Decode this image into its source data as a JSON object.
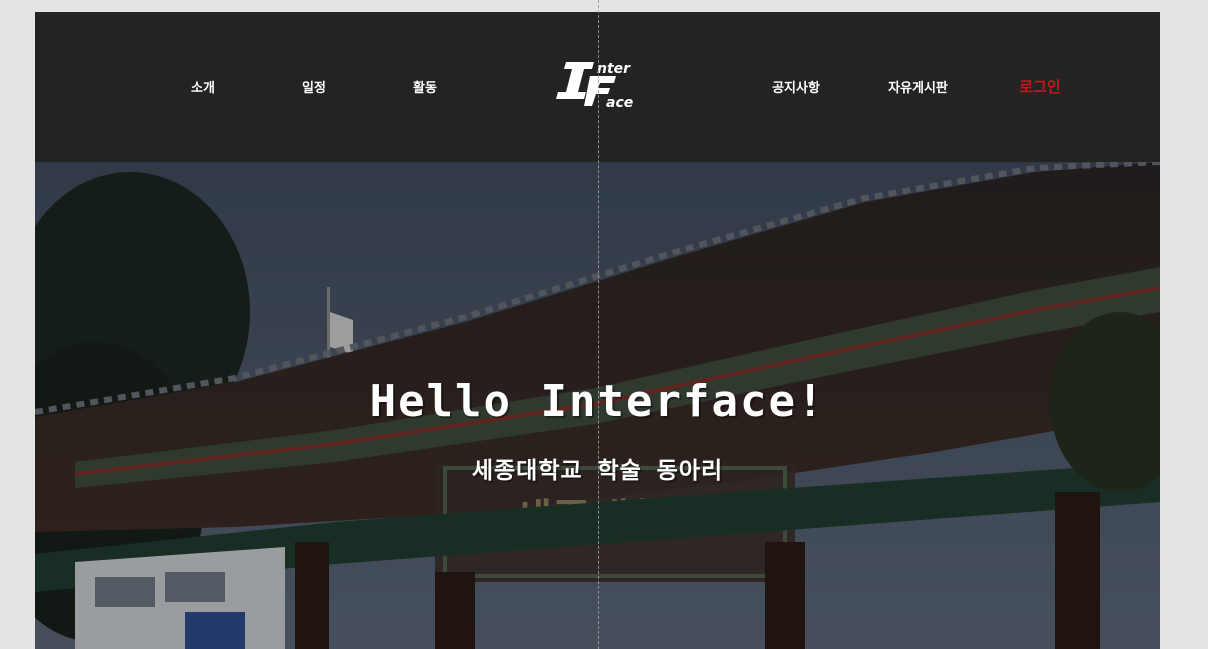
{
  "nav": {
    "left_items": [
      {
        "label": "소개"
      },
      {
        "label": "일정"
      },
      {
        "label": "활동"
      }
    ],
    "right_items": [
      {
        "label": "공지사항"
      },
      {
        "label": "자유게시판"
      }
    ],
    "login_label": "로그인",
    "logo_text": {
      "top": "nter",
      "bottom": "ace"
    }
  },
  "hero": {
    "title": "Hello Interface!",
    "subtitle": "세종대학교 학술 동아리",
    "sign_text": "세종대학교"
  },
  "colors": {
    "header_bg": "#232323",
    "login_accent": "#c8161d",
    "page_bg": "#e4e4e4"
  }
}
